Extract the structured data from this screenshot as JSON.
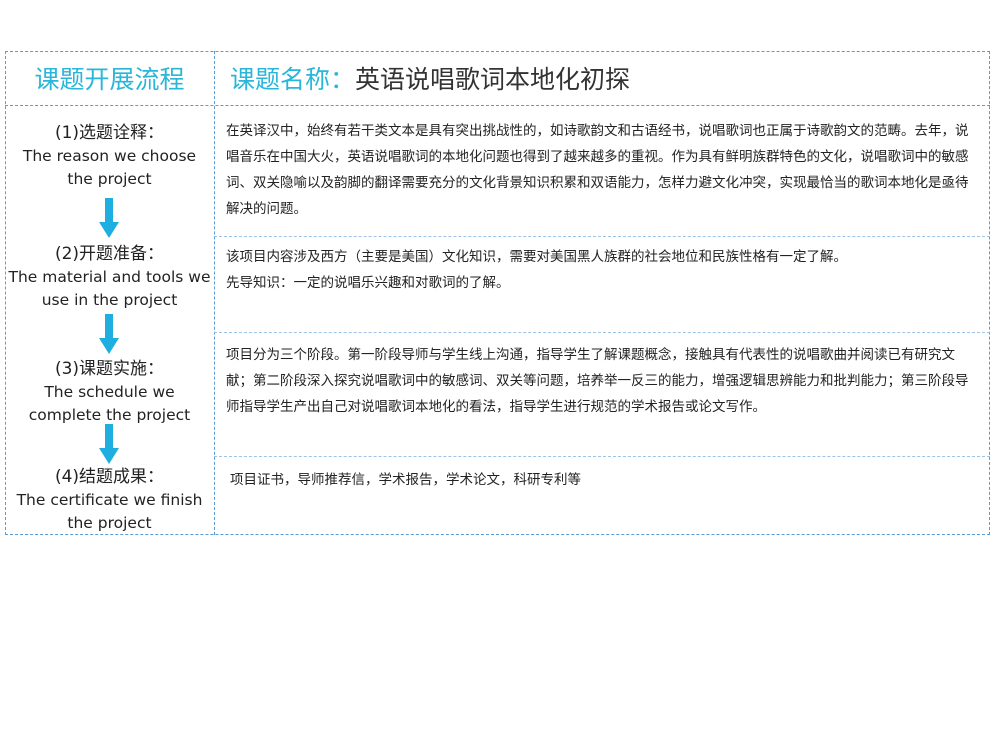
{
  "header": {
    "left_title": "课题开展流程",
    "right_label": "课题名称：",
    "right_value": "英语说唱歌词本地化初探"
  },
  "steps": [
    {
      "cn": "(1)选题诠释：",
      "en": "The reason we choose the project"
    },
    {
      "cn": "(2)开题准备：",
      "en": "The material and tools we use in the project"
    },
    {
      "cn": "(3)课题实施：",
      "en": "The schedule we complete the project"
    },
    {
      "cn": "(4)结题成果：",
      "en": "The certificate we finish the project"
    }
  ],
  "contents": [
    {
      "lines": [
        "在英译汉中，始终有若干类文本是具有突出挑战性的，如诗歌韵文和古语经书，说唱歌词也正属于诗歌韵文的范畴。去年，说唱音乐在中国大火，英语说唱歌词的本地化问题也得到了越来越多的重视。作为具有鲜明族群特色的文化，说唱歌词中的敏感词、双关隐喻以及韵脚的翻译需要充分的文化背景知识积累和双语能力，怎样力避文化冲突，实现最恰当的歌词本地化是亟待解决的问题。"
      ]
    },
    {
      "lines": [
        "该项目内容涉及西方（主要是美国）文化知识，需要对美国黑人族群的社会地位和民族性格有一定了解。",
        "先导知识：一定的说唱乐兴趣和对歌词的了解。"
      ]
    },
    {
      "lines": [
        "项目分为三个阶段。第一阶段导师与学生线上沟通，指导学生了解课题概念，接触具有代表性的说唱歌曲并阅读已有研究文献；第二阶段深入探究说唱歌词中的敏感词、双关等问题，培养举一反三的能力，增强逻辑思辨能力和批判能力；第三阶段导师指导学生产出自己对说唱歌词本地化的看法，指导学生进行规范的学术报告或论文写作。"
      ]
    },
    {
      "lines": [
        "项目证书，导师推荐信，学术报告，学术论文，科研专利等"
      ]
    }
  ],
  "colors": {
    "accent": "#29b6d9",
    "border": "#5b9bd5",
    "arrow": "#1eaee0"
  }
}
